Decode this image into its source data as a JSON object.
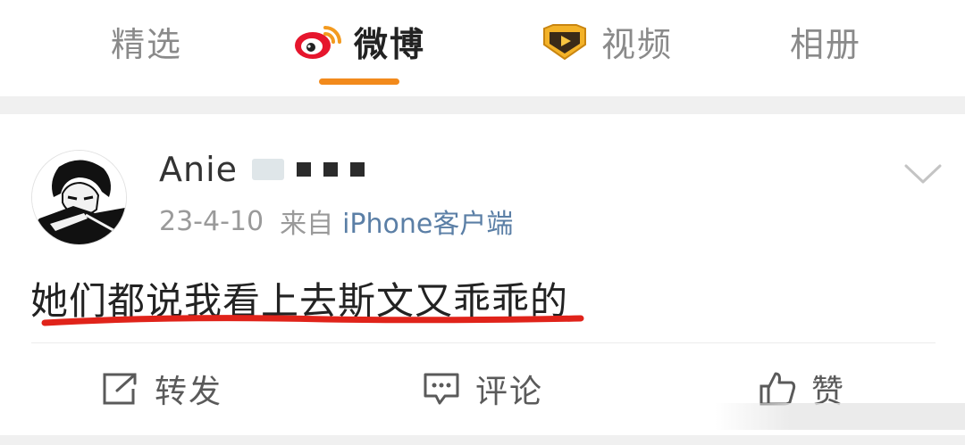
{
  "tabs": [
    {
      "label": "精选",
      "active": false
    },
    {
      "label": "微博",
      "active": true
    },
    {
      "label": "视频",
      "active": false
    },
    {
      "label": "相册",
      "active": false
    }
  ],
  "post": {
    "username": "Anie",
    "date": "23-4-10",
    "from_label": "来自",
    "source": "iPhone客户端",
    "text": "她们都说我看上去斯文又乖乖的"
  },
  "actions": {
    "repost": "转发",
    "comment": "评论",
    "like": "赞"
  },
  "colors": {
    "accent": "#f28a1c",
    "link": "#5b7fa6",
    "annotation": "#e0231a"
  }
}
